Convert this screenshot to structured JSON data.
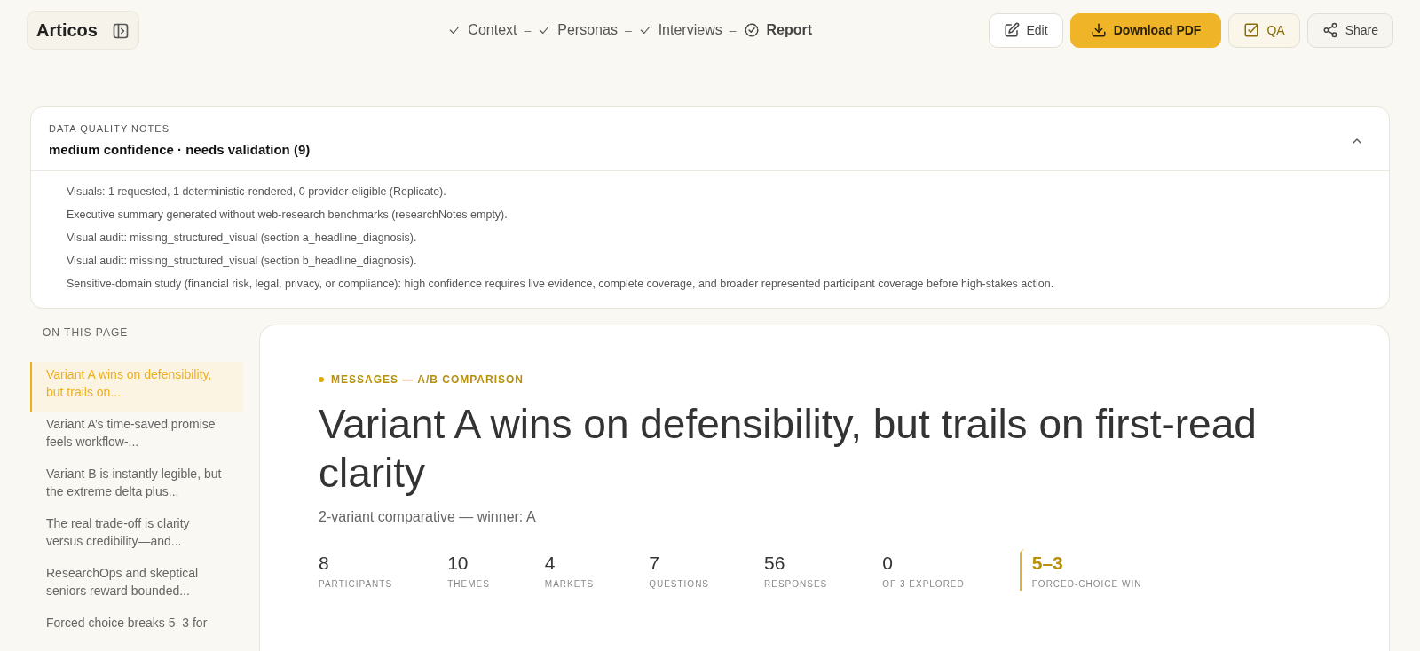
{
  "app": {
    "title": "Articos"
  },
  "steps": [
    {
      "label": "Context",
      "done": true,
      "selected": false,
      "separator": "–"
    },
    {
      "label": "Personas",
      "done": true,
      "selected": false,
      "separator": "–"
    },
    {
      "label": "Interviews",
      "done": true,
      "selected": false,
      "separator": "–"
    },
    {
      "label": "Report",
      "done": false,
      "selected": true
    }
  ],
  "actions": [
    {
      "label": "Edit",
      "kind": "edit"
    },
    {
      "label": "Download PDF",
      "kind": "primary"
    },
    {
      "label": "QA",
      "kind": "qa"
    },
    {
      "label": "Share",
      "kind": "share"
    }
  ],
  "notes": {
    "eyebrow": "DATA QUALITY NOTES",
    "summary": "medium confidence · needs validation (9)",
    "expanded": true,
    "items": [
      "Visuals: 1 requested, 1 deterministic-rendered, 0 provider-eligible (Replicate).",
      "Executive summary generated without web-research benchmarks (researchNotes empty).",
      "Visual audit: missing_structured_visual (section a_headline_diagnosis).",
      "Visual audit: missing_structured_visual (section b_headline_diagnosis).",
      "Sensitive-domain study (financial risk, legal, privacy, or compliance): high confidence requires live evidence, complete coverage, and broader represented participant coverage before high-stakes action."
    ]
  },
  "toc": {
    "heading": "ON THIS PAGE",
    "items": [
      {
        "label": "Variant A wins on defensibility, but trails on...",
        "selected": true
      },
      {
        "label": "Variant A’s time-saved promise feels workflow-...",
        "selected": false
      },
      {
        "label": "Variant B is instantly legible, but the extreme delta plus...",
        "selected": false
      },
      {
        "label": "The real trade-off is clarity versus credibility—and...",
        "selected": false
      },
      {
        "label": "ResearchOps and skeptical seniors reward bounded...",
        "selected": false
      },
      {
        "label": "Forced choice breaks 5–3 for",
        "selected": false
      }
    ]
  },
  "report": {
    "eyebrow": "MESSAGES — A/B COMPARISON",
    "title": "Variant A wins on defensibility, but trails on first-read clarity",
    "subtitle": "2-variant comparative — winner: A",
    "stats": [
      {
        "value": "8",
        "label": "PARTICIPANTS",
        "highlight": false
      },
      {
        "value": "10",
        "label": "THEMES",
        "highlight": false
      },
      {
        "value": "4",
        "label": "MARKETS",
        "highlight": false
      },
      {
        "value": "7",
        "label": "QUESTIONS",
        "highlight": false
      },
      {
        "value": "56",
        "label": "RESPONSES",
        "highlight": false
      },
      {
        "value": "0",
        "label": "OF 3 EXPLORED",
        "highlight": false
      },
      {
        "value": "5–3",
        "label": "FORCED-CHOICE WIN",
        "highlight": true
      }
    ]
  }
}
